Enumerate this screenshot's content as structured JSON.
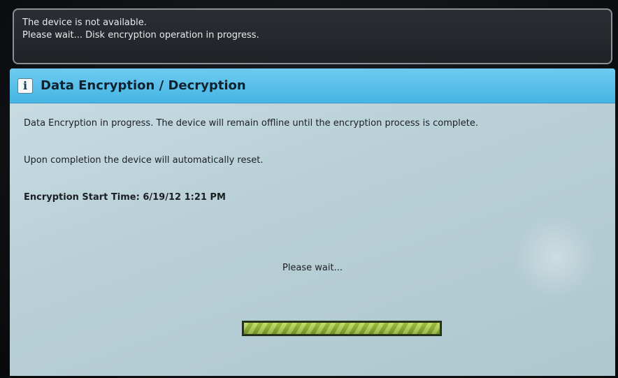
{
  "status": {
    "line1": "The device is not available.",
    "line2": "Please wait... Disk encryption operation in progress."
  },
  "panel": {
    "icon": "info-icon",
    "icon_glyph": "i",
    "title": "Data Encryption / Decryption",
    "message1": "Data Encryption in progress. The device will remain offline until the encryption process is complete.",
    "message2": "Upon completion the device will automatically reset.",
    "start_time": "Encryption Start Time: 6/19/12 1:21 PM",
    "wait_text": "Please wait..."
  },
  "progress": {
    "fraction": 1.0,
    "colors": {
      "fill": "#9cc23a",
      "track": "#2b3a1c"
    }
  },
  "colors": {
    "header": "#4fbbe8",
    "panel_bg": "#bdd3d9",
    "status_bg": "#24272b"
  }
}
